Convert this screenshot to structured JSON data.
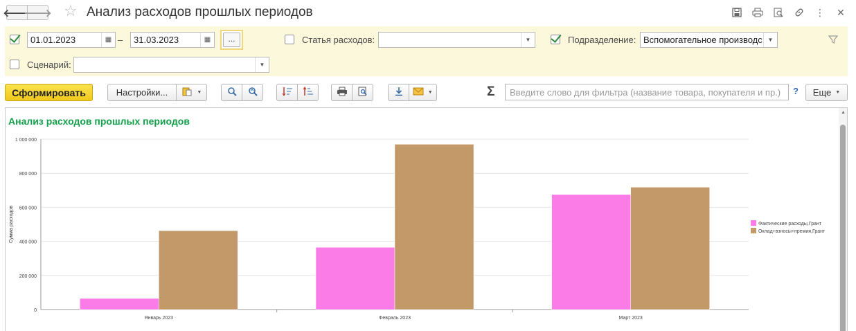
{
  "window": {
    "title": "Анализ расходов прошлых периодов",
    "back_icon": "🡐",
    "forward_icon": "🡒"
  },
  "filters": {
    "date_from": "01.01.2023",
    "date_separator": "–",
    "date_to": "31.03.2023",
    "period_button": "...",
    "expense_label": "Статья расходов:",
    "expense_value": "",
    "division_label": "Подразделение:",
    "division_value": "Вспомогательное производс",
    "scenario_label": "Сценарий:",
    "scenario_value": ""
  },
  "toolbar": {
    "generate": "Сформировать",
    "settings": "Настройки...",
    "more": "Еще",
    "search_placeholder": "Введите слово для фильтра (название товара, покупателя и пр.)",
    "sigma": "Σ",
    "help": "?"
  },
  "report": {
    "title": "Анализ расходов прошлых периодов"
  },
  "chart_data": {
    "type": "bar",
    "title": "",
    "xlabel": "",
    "ylabel": "Сумма расходов",
    "categories": [
      "Январь 2023",
      "Февраль 2023",
      "Март 2023"
    ],
    "series": [
      {
        "name": "Фактические расходы,Грант",
        "color": "#fb7ce7",
        "values": [
          65000,
          365000,
          675000
        ]
      },
      {
        "name": "Оклад+взносы+премия,Грант",
        "color": "#c4996a",
        "values": [
          463000,
          970000,
          718000
        ]
      }
    ],
    "ylim": [
      0,
      1000000
    ],
    "yticks": [
      0,
      200000,
      400000,
      600000,
      800000,
      1000000
    ],
    "ytick_labels": [
      "0",
      "200 000",
      "400 000",
      "600 000",
      "800 000",
      "1 000 000"
    ],
    "grid": true,
    "legend": "right"
  }
}
